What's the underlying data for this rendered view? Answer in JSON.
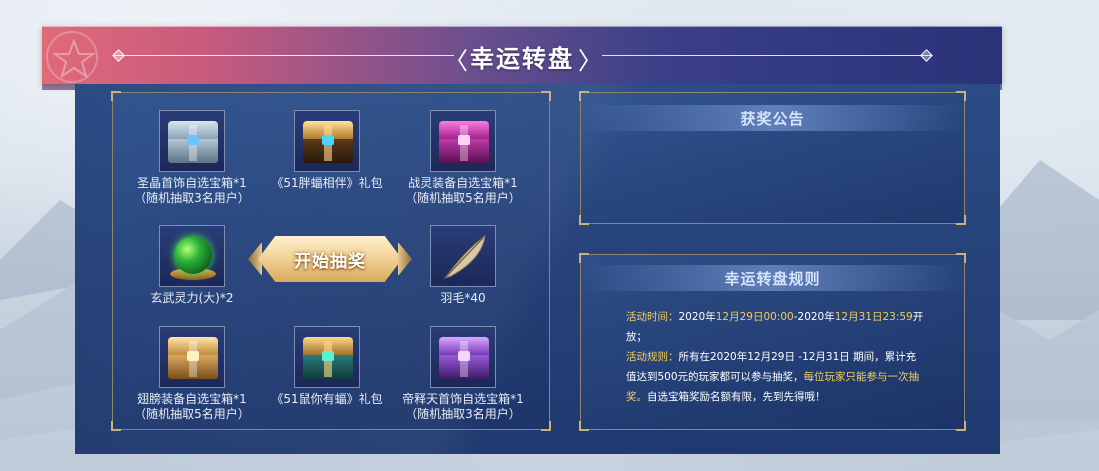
{
  "header": {
    "title": "幸运转盘"
  },
  "prizes": [
    {
      "name": "圣晶首饰自选宝箱*1",
      "sub": "（随机抽取3名用户）",
      "icon": "silver-chest-icon"
    },
    {
      "name": "《51胖蝠相伴》礼包",
      "sub": "",
      "icon": "gold-chest-icon"
    },
    {
      "name": "战灵装备自选宝箱*1",
      "sub": "（随机抽取5名用户）",
      "icon": "magenta-chest-icon"
    },
    {
      "name": "玄武灵力(大)*2",
      "sub": "",
      "icon": "green-orb-icon"
    },
    {
      "name": "羽毛*40",
      "sub": "",
      "icon": "feather-icon"
    },
    {
      "name": "翅膀装备自选宝箱*1",
      "sub": "（随机抽取5名用户）",
      "icon": "gold-chest-icon"
    },
    {
      "name": "《51鼠你有蝠》礼包",
      "sub": "",
      "icon": "gold-teal-chest-icon"
    },
    {
      "name": "帝释天首饰自选宝箱*1",
      "sub": "（随机抽取3名用户）",
      "icon": "purple-chest-icon"
    }
  ],
  "start_button": {
    "label": "开始抽奖"
  },
  "announcement": {
    "title": "获奖公告"
  },
  "rules": {
    "title": "幸运转盘规则",
    "time_label": "活动时间：",
    "time_pre": "2020年",
    "time_d1": "12月29日00:00",
    "time_mid": "-2020年",
    "time_d2": "12月31日23:59",
    "time_post": "开放；",
    "rule_label": "活动规则：",
    "rule_text": "所有在2020年12月29日 -12月31日 期间，累计充值达到500元的玩家都可以参与抽奖，",
    "rule_highlight": "每位玩家只能参与一次抽奖。",
    "rule_tail": "自选宝箱奖励名额有限，先到先得哦！"
  },
  "colors": {
    "highlight": "#f3cf5a",
    "panel": "#264279",
    "header_left": "#e06a78",
    "header_right": "#2a3278"
  }
}
